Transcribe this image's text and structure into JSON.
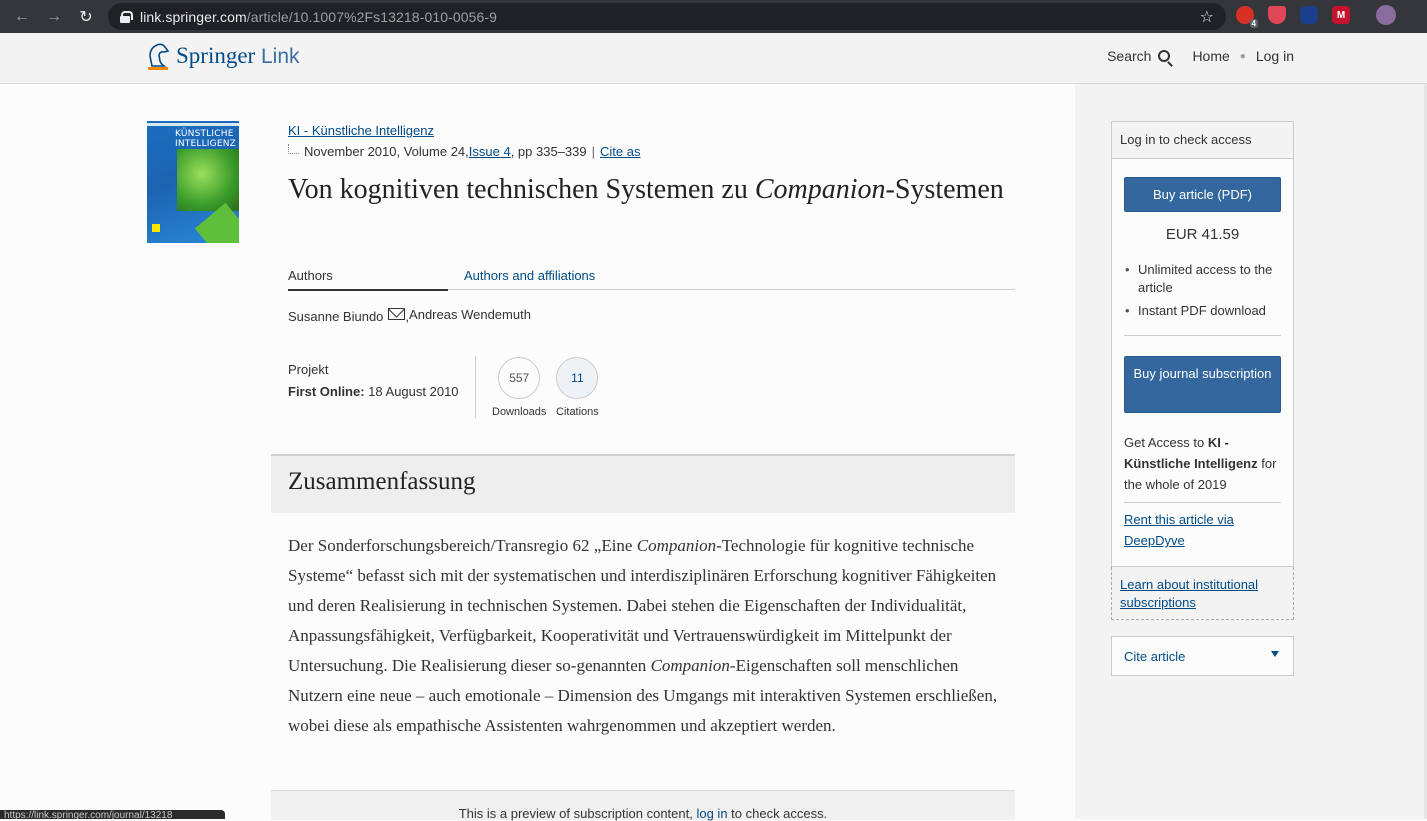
{
  "browser": {
    "url_host": "link.springer.com",
    "url_path": "/article/10.1007%2Fs13218-010-0056-9",
    "extension_badge": "4",
    "status_url": "https://link.springer.com/journal/13218"
  },
  "header": {
    "logo_main": "Springer",
    "logo_suffix": "Link",
    "search_label": "Search",
    "home_label": "Home",
    "login_label": "Log in"
  },
  "cover": {
    "title_line1": "KÜNSTLICHE",
    "title_line2": "INTELLIGENZ"
  },
  "article": {
    "journal": "KI - Künstliche Intelligenz",
    "bib_date_volume": "November 2010, Volume 24, ",
    "issue": "Issue 4",
    "pages": ", pp 335–339",
    "cite_as": "Cite as",
    "title_part1": "Von kognitiven technischen Systemen zu ",
    "title_italic": "Companion",
    "title_part2": "-Systemen",
    "tab_authors": "Authors",
    "tab_affiliations": "Authors and affiliations",
    "author1": "Susanne Biundo",
    "author_sep": ", ",
    "author2": "Andreas Wendemuth",
    "type": "Projekt",
    "first_online_label": "First Online:",
    "first_online_date": " 18 August 2010",
    "downloads_count": "557",
    "downloads_label": "Downloads",
    "citations_count": "11",
    "citations_label": "Citations"
  },
  "abstract": {
    "heading": "Zusammenfassung",
    "t1": "Der Sonderforschungsbereich/Transregio 62 „Eine ",
    "t1_i": "Companion",
    "t2": "-Technologie für kognitive technische Systeme“ befasst sich mit der systematischen und interdisziplinären Erforschung kognitiver Fähigkeiten und deren Realisierung in technischen Systemen. Dabei stehen die Eigenschaften der Individualität, Anpassungsfähigkeit, Verfügbarkeit, Kooperativität und Vertrauenswürdigkeit im Mittelpunkt der Untersuchung. Die Realisierung dieser so-genannten ",
    "t2_i": "Companion",
    "t3": "-Eigenschaften soll menschlichen Nutzern eine neue – auch emotionale – Dimension des Umgangs mit interaktiven Systemen erschließen, wobei diese als empathische Assistenten wahrgenommen und akzeptiert werden."
  },
  "preview": {
    "text_before": "This is a preview of subscription content, ",
    "link": "log in",
    "text_after": " to check access."
  },
  "sidebar": {
    "access_heading": "Log in to check access",
    "buy_article": "Buy article (PDF)",
    "price": "EUR 41.59",
    "feature1": "Unlimited access to the article",
    "feature2": "Instant PDF download",
    "buy_journal": "Buy journal subscription",
    "get_access_prefix": "Get Access to ",
    "get_access_journal": "KI - Künstliche Intelligenz",
    "get_access_suffix": " for the whole of 2019",
    "rent": "Rent this article via DeepDyve",
    "institutional": "Learn about institutional subscriptions",
    "cite_article": "Cite article"
  },
  "colors": {
    "link": "#004b87",
    "button": "#35679f",
    "chrome": "#35363a"
  }
}
